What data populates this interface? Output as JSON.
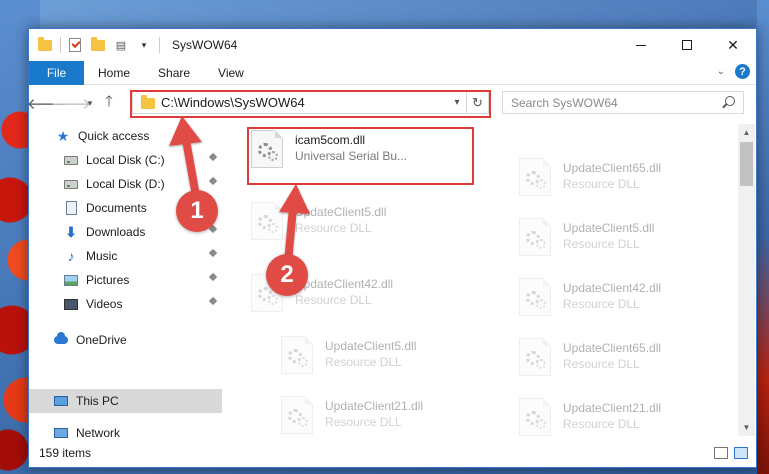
{
  "window": {
    "title": "SysWOW64"
  },
  "ribbon": {
    "tabs": [
      "File",
      "Home",
      "Share",
      "View"
    ]
  },
  "address": {
    "path": "C:\\Windows\\SysWOW64",
    "search_placeholder": "Search SysWOW64"
  },
  "nav": {
    "items": [
      {
        "label": "Quick access",
        "icon": "star-icon"
      },
      {
        "label": "Local Disk (C:)",
        "icon": "drive-icon"
      },
      {
        "label": "Local Disk (D:)",
        "icon": "drive-icon"
      },
      {
        "label": "Documents",
        "icon": "documents-icon"
      },
      {
        "label": "Downloads",
        "icon": "downloads-icon"
      },
      {
        "label": "Music",
        "icon": "music-icon"
      },
      {
        "label": "Pictures",
        "icon": "pictures-icon"
      },
      {
        "label": "Videos",
        "icon": "videos-icon"
      },
      {
        "label": "OneDrive",
        "icon": "onedrive-icon"
      },
      {
        "label": "This PC",
        "icon": "this-pc-icon"
      },
      {
        "label": "Network",
        "icon": "network-icon"
      }
    ]
  },
  "files": {
    "highlighted": {
      "name": "icam5com.dll",
      "desc": "Universal Serial Bu..."
    },
    "left_column": [
      {
        "name": "UpdateClient5.dll",
        "desc": "Resource DLL"
      },
      {
        "name": "UpdateClient42.dll",
        "desc": "Resource DLL"
      },
      {
        "name": "UpdateClient5.dll",
        "desc": "Resource DLL"
      },
      {
        "name": "UpdateClient21.dll",
        "desc": "Resource DLL"
      }
    ],
    "right_column": [
      {
        "name": "UpdateClient65.dll",
        "desc": "Resource DLL"
      },
      {
        "name": "UpdateClient5.dll",
        "desc": "Resource DLL"
      },
      {
        "name": "UpdateClient42.dll",
        "desc": "Resource DLL"
      },
      {
        "name": "UpdateClient65.dll",
        "desc": "Resource DLL"
      },
      {
        "name": "UpdateClient21.dll",
        "desc": "Resource DLL"
      }
    ]
  },
  "status": {
    "count": "159 items"
  },
  "annotations": {
    "step1": "1",
    "step2": "2"
  },
  "colors": {
    "accent": "#1979ca",
    "highlight_box": "#e03a3a",
    "badge": "#e04b45"
  }
}
